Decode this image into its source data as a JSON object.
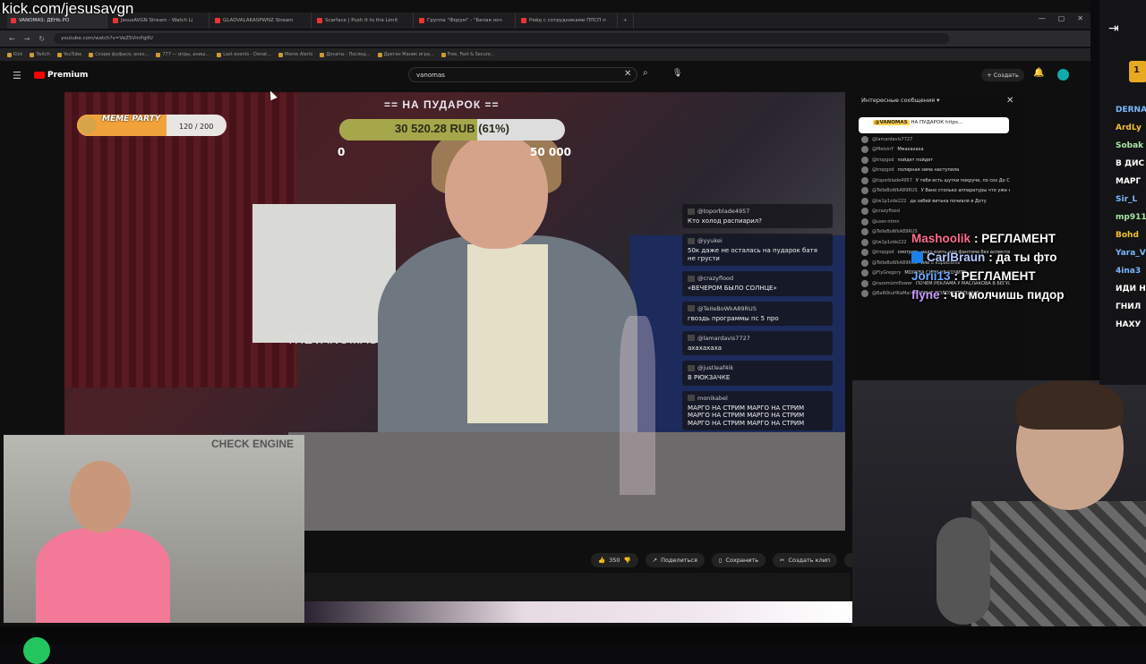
{
  "kick_url": "kick.com/jesusavgn",
  "browser": {
    "tabs": [
      {
        "label": "VANOMAS: ДЕНЬ РО",
        "active": true
      },
      {
        "label": "JesusAVGN Stream - Watch Li",
        "active": false
      },
      {
        "label": "GLADVALAKASPWNZ Stream",
        "active": false
      },
      {
        "label": "Scarface | Push It to the Limit",
        "active": false
      },
      {
        "label": "Группа \"Форум\" - \"Белая ноч",
        "active": false
      },
      {
        "label": "Рейд с сотрудниками ППСП п",
        "active": false
      }
    ],
    "url": "youtube.com/watch?v=VeZ5VmPglfU",
    "bookmarks": [
      "Kick",
      "Twitch",
      "YouTube",
      "Скорю фуфыся, анко...",
      "777 — игры, аниш...",
      "Last events - Donat...",
      "Meme Alerts",
      "Донаты - Послед...",
      "Дрегон Маник игра...",
      "Free, Fast & Secure..."
    ]
  },
  "youtube": {
    "logo": "Premium",
    "search_query": "vanomas",
    "create_label": "Создать",
    "actions": {
      "likes": "350",
      "share": "Поделиться",
      "save": "Сохранить",
      "clip": "Создать клип"
    }
  },
  "stream_overlay": {
    "donation_title": "== НА ПУДАРОК ==",
    "donation_amount": "30 520.28 RUB (61%)",
    "donation_progress": 0.61,
    "donation_min": "0",
    "donation_max": "50 000",
    "meme_party_label": "MEME PARTY",
    "meme_party_count": "120 / 200",
    "meme_party_progress": 0.6,
    "channel_watermark": "THEVANOMAS",
    "chat": [
      {
        "user": "@toporblade4957",
        "text": "Кто холод распиарил?"
      },
      {
        "user": "@yyukei",
        "text": "50к даже не осталась на пударок батя не грусти"
      },
      {
        "user": "@crazyflood",
        "text": "«ВЕЧЕРОМ БЫЛО СОЛНЦЕ»"
      },
      {
        "user": "@TeIIeBoWkA89RUS",
        "text": "гвоздь программы пс 5 про"
      },
      {
        "user": "@lamardavis7727",
        "text": "ахахахаха"
      },
      {
        "user": "@justleaf4ik",
        "text": "В РЮКЗАЧКЕ"
      },
      {
        "user": "monikabel",
        "text": "МАРГО НА СТРИМ МАРГО НА СТРИМ МАРГО НА СТРИМ МАРГО НА СТРИМ МАРГО НА СТРИМ МАРГО НА СТРИМ"
      }
    ]
  },
  "youtube_chat": {
    "header": "Интересные сообщения",
    "pinned_user": "@VANOMAS",
    "pinned_text": "НА ПУДАРОК https...",
    "messages": [
      {
        "user": "@lamardavis7727",
        "text": ""
      },
      {
        "user": "@MelvinY",
        "text": "Ммахахаха"
      },
      {
        "user": "@tropgod",
        "text": "пойдет пойдет"
      },
      {
        "user": "@tropgod",
        "text": "полярная зима наступила"
      },
      {
        "user": "@toporblade4957",
        "text": "У тебя есть шутки покруче, по сох До Семон например, нетронутый"
      },
      {
        "user": "@TeIIeBoWkA89RUS",
        "text": "У Вано столько аппаратуры что уже не помещается"
      },
      {
        "user": "@lw1p1zde222",
        "text": "да забей витька почиаля в Доту"
      },
      {
        "user": "@crazyflood",
        "text": ""
      },
      {
        "user": "@user-ntmn",
        "text": ""
      },
      {
        "user": "@TeIIeBoWkA89RUS",
        "text": ""
      },
      {
        "user": "@lw1p1zde222",
        "text": ""
      },
      {
        "user": "@tropgod",
        "text": "смотреть надо взять или фантома без аспектов"
      },
      {
        "user": "@TeIIeBoWkA89RUS",
        "text": "или в кораблике"
      },
      {
        "user": "@FlyGregory",
        "text": "МОСКВА СИТИ НЕ ХОЧИТЕ"
      },
      {
        "user": "@razomizmflower",
        "text": "ПОЧЕМ РЕКЛАМА У МАСЛАКОВА В БЕГУЩЕЙ СТРОКЕ ЗА ДЕНЬ?"
      },
      {
        "user": "@BaR0kuHKaMal",
        "text": "ДОБРЫЕ ПОЛОЖИТЕЛЬНЫЕ"
      }
    ]
  },
  "kick_chat_overlay": [
    {
      "user": "Mashoolik",
      "text": ": РЕГЛАМЕНТ",
      "color": "#ff6b8a",
      "badge": false
    },
    {
      "user": "CarlBraun",
      "text": ": да ты фто",
      "color": "#b5c8ff",
      "badge": true
    },
    {
      "user": "Jorii13",
      "text": ": РЕГЛАМЕНТ",
      "color": "#6aa8ff",
      "badge": false
    },
    {
      "user": "flyne",
      "text": ": чо молчишь пидор",
      "color": "#c79bff",
      "badge": false
    }
  ],
  "kick_sidebar": {
    "badge": "1",
    "users": [
      {
        "name": "DERNA",
        "color": "#7ab8ff"
      },
      {
        "name": "ArdLy",
        "color": "#f1c232"
      },
      {
        "name": "Sobak",
        "color": "#a8e6a3"
      },
      {
        "name": "В ДИС",
        "color": "#ffffff"
      },
      {
        "name": "МАРГ",
        "color": "#ffffff"
      },
      {
        "name": "Sir_L",
        "color": "#7ab8ff"
      },
      {
        "name": "mp911",
        "color": "#a8e6a3"
      },
      {
        "name": "Bohd",
        "color": "#f1c232"
      },
      {
        "name": "Yara_V",
        "color": "#7ab8ff"
      },
      {
        "name": "4ina3",
        "color": "#7ab8ff"
      },
      {
        "name": "ИДИ Н",
        "color": "#ffffff"
      },
      {
        "name": "ГНИЛ",
        "color": "#ffffff"
      },
      {
        "name": "НАХУ",
        "color": "#ffffff"
      }
    ]
  },
  "webcam_left_sign": "CHECK ENGINE",
  "colors": {
    "accent_red": "#ff0000",
    "kick_green": "#22c55e"
  }
}
